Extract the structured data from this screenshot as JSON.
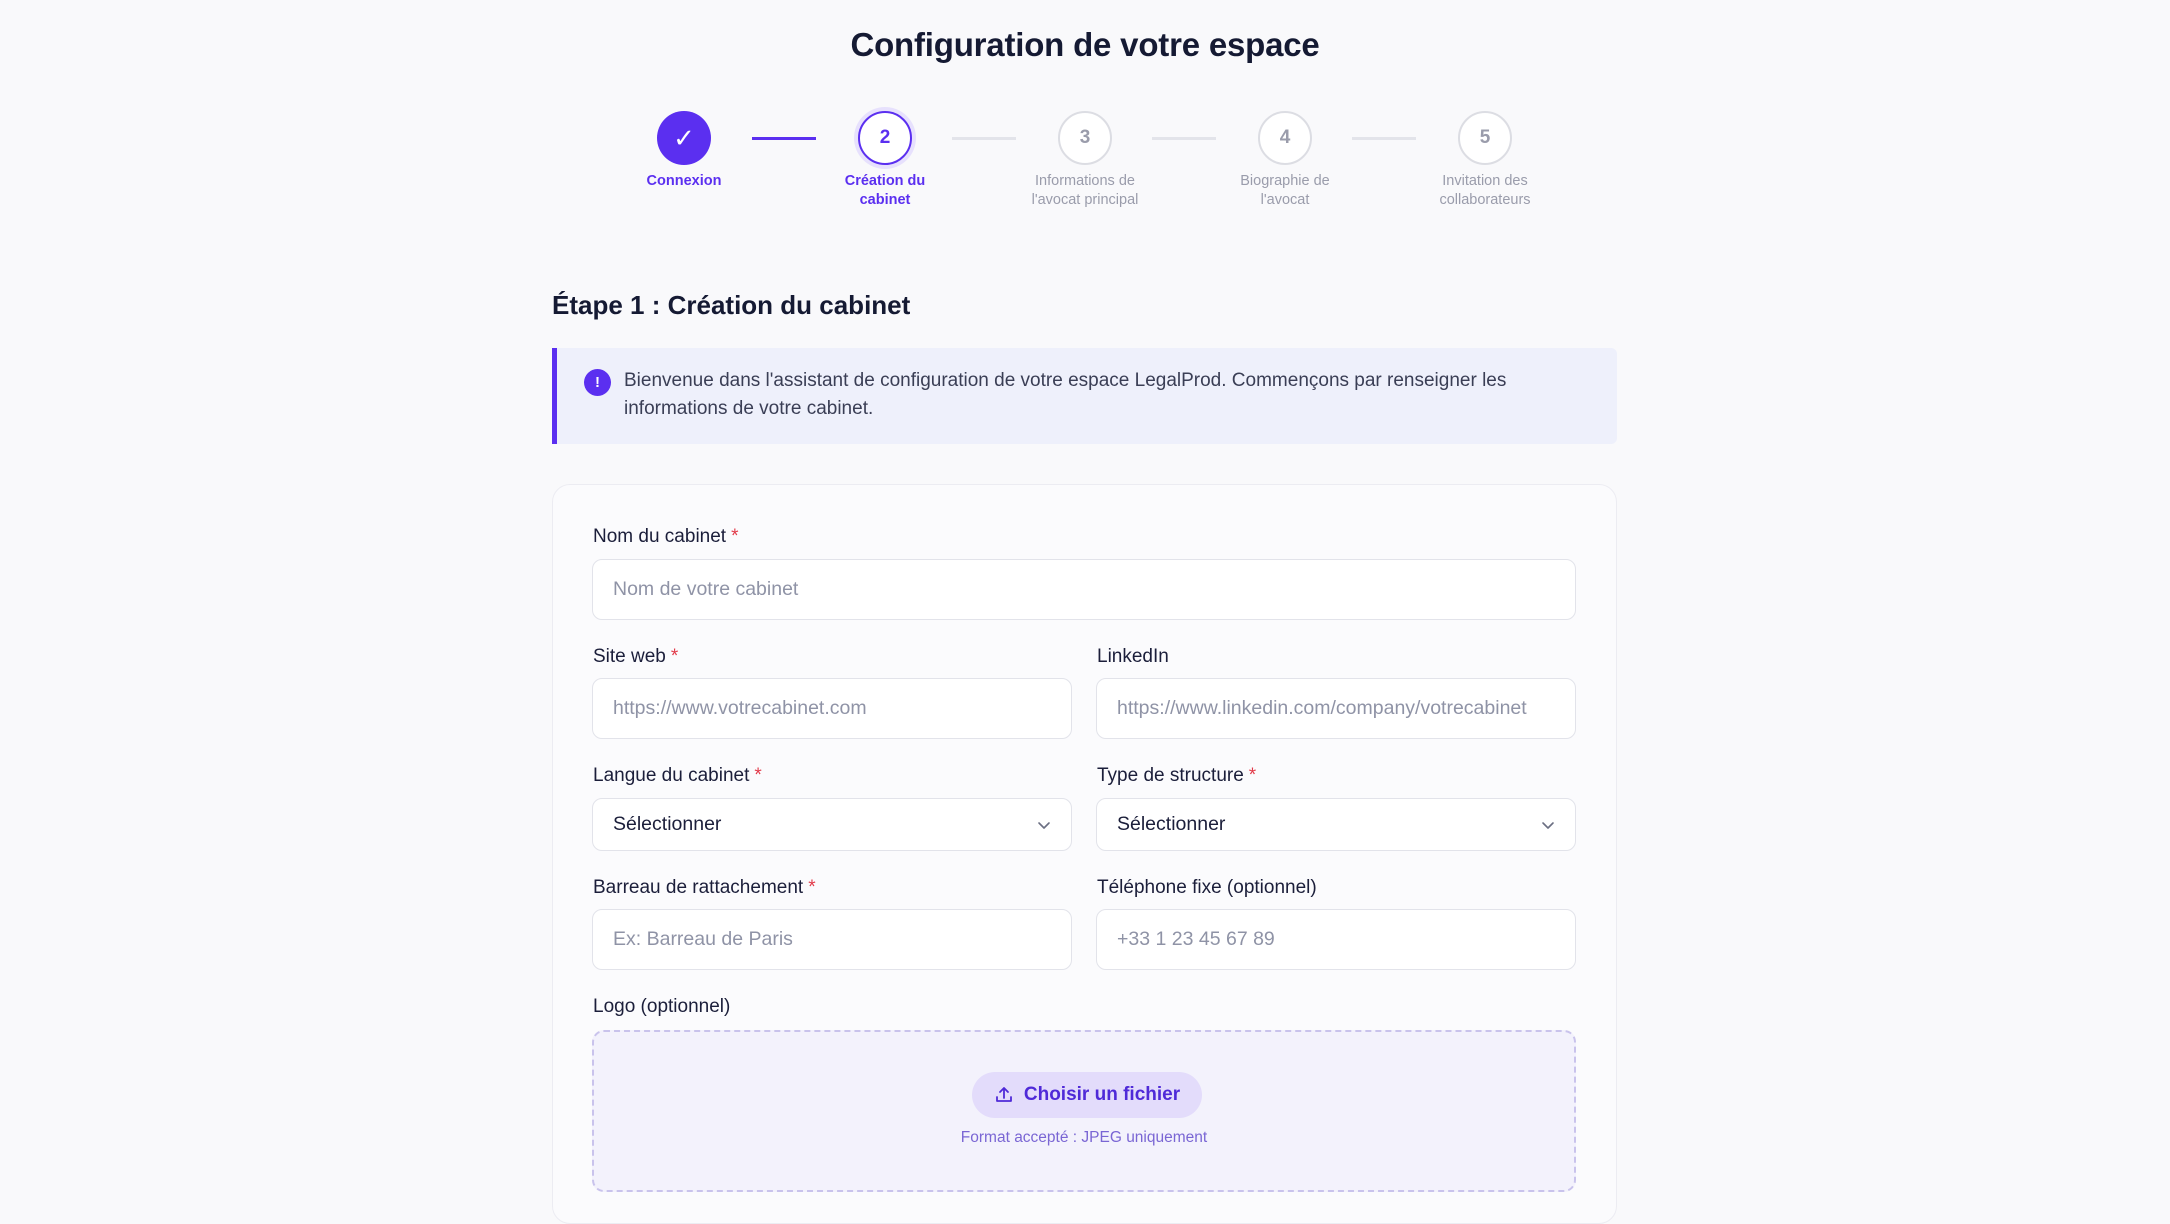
{
  "header": {
    "title": "Configuration de votre espace"
  },
  "stepper": {
    "steps": [
      {
        "number": "✓",
        "label": "Connexion",
        "state": "done"
      },
      {
        "number": "2",
        "label": "Création du cabinet",
        "state": "active"
      },
      {
        "number": "3",
        "label": "Informations de l'avocat principal",
        "state": "pending"
      },
      {
        "number": "4",
        "label": "Biographie de l'avocat",
        "state": "pending"
      },
      {
        "number": "5",
        "label": "Invitation des collaborateurs",
        "state": "pending"
      }
    ]
  },
  "section": {
    "title": "Étape 1 : Création du cabinet"
  },
  "info": {
    "icon": "!",
    "text": "Bienvenue dans l'assistant de configuration de votre espace LegalProd. Commençons par renseigner les informations de votre cabinet."
  },
  "form": {
    "required_mark": "*",
    "nom": {
      "label": "Nom du cabinet",
      "placeholder": "Nom de votre cabinet"
    },
    "site": {
      "label": "Site web",
      "placeholder": "https://www.votrecabinet.com"
    },
    "linkedin": {
      "label": "LinkedIn",
      "placeholder": "https://www.linkedin.com/company/votrecabinet"
    },
    "langue": {
      "label": "Langue du cabinet",
      "value": "Sélectionner"
    },
    "structure": {
      "label": "Type de structure",
      "value": "Sélectionner"
    },
    "barreau": {
      "label": "Barreau de rattachement",
      "placeholder": "Ex: Barreau de Paris"
    },
    "telephone": {
      "label": "Téléphone fixe (optionnel)",
      "placeholder": "+33 1 23 45 67 89"
    },
    "logo": {
      "label": "Logo (optionnel)",
      "button": "Choisir un fichier",
      "hint": "Format accepté : JPEG uniquement"
    }
  },
  "colors": {
    "accent": "#5b2ff0",
    "required": "#e23b4a"
  },
  "icons": {
    "done": "check-icon",
    "info": "info-icon",
    "upload": "upload-icon",
    "select": "chevron-down-icon"
  }
}
